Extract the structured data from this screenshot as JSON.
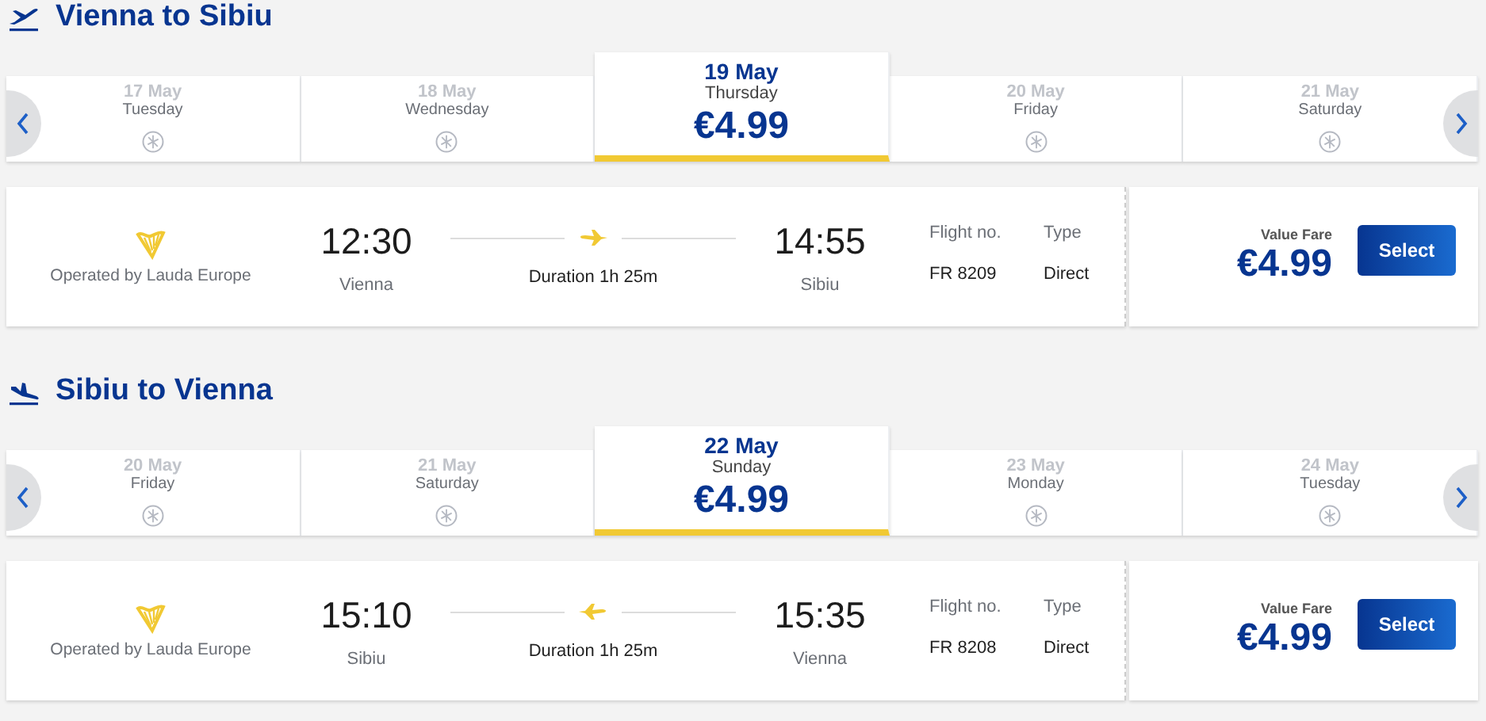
{
  "journeys": [
    {
      "kind": "outbound",
      "title": "Vienna to Sibiu",
      "dates": [
        {
          "date": "17 May",
          "weekday": "Tuesday",
          "selected": false
        },
        {
          "date": "18 May",
          "weekday": "Wednesday",
          "selected": false
        },
        {
          "date": "19 May",
          "weekday": "Thursday",
          "price": "€4.99",
          "selected": true
        },
        {
          "date": "20 May",
          "weekday": "Friday",
          "selected": false
        },
        {
          "date": "21 May",
          "weekday": "Saturday",
          "selected": false
        }
      ],
      "flight": {
        "operator": "Operated by Lauda Europe",
        "departure_time": "12:30",
        "departure_city": "Vienna",
        "duration": "Duration 1h 25m",
        "arrival_time": "14:55",
        "arrival_city": "Sibiu",
        "flight_no_label": "Flight no.",
        "flight_no": "FR 8209",
        "type_label": "Type",
        "type": "Direct",
        "fare_label": "Value Fare",
        "fare": "€4.99",
        "button": "Select"
      }
    },
    {
      "kind": "inbound",
      "title": "Sibiu to Vienna",
      "dates": [
        {
          "date": "20 May",
          "weekday": "Friday",
          "selected": false
        },
        {
          "date": "21 May",
          "weekday": "Saturday",
          "selected": false
        },
        {
          "date": "22 May",
          "weekday": "Sunday",
          "price": "€4.99",
          "selected": true
        },
        {
          "date": "23 May",
          "weekday": "Monday",
          "selected": false
        },
        {
          "date": "24 May",
          "weekday": "Tuesday",
          "selected": false
        }
      ],
      "flight": {
        "operator": "Operated by Lauda Europe",
        "departure_time": "15:10",
        "departure_city": "Sibiu",
        "duration": "Duration 1h 25m",
        "arrival_time": "15:35",
        "arrival_city": "Vienna",
        "flight_no_label": "Flight no.",
        "flight_no": "FR 8208",
        "type_label": "Type",
        "type": "Direct",
        "fare_label": "Value Fare",
        "fare": "€4.99",
        "button": "Select"
      }
    }
  ]
}
